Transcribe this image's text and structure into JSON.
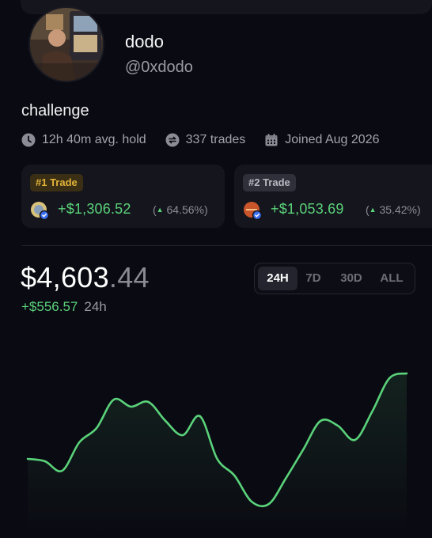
{
  "profile": {
    "display_name": "dodo",
    "handle": "@0xdodo",
    "bio": "challenge"
  },
  "stats": [
    {
      "icon": "clock-icon",
      "label": "12h 40m avg. hold"
    },
    {
      "icon": "swap-icon",
      "label": "337 trades"
    },
    {
      "icon": "calendar-icon",
      "label": "Joined Aug 2026"
    }
  ],
  "trades": [
    {
      "rank": "#1 Trade",
      "pnl": "+$1,306.52",
      "pct": "64.56%)",
      "pct_prefix": "(",
      "token_icon": "token-avatar-icon",
      "badge_color": "#e3b33b"
    },
    {
      "rank": "#2 Trade",
      "pnl": "+$1,053.69",
      "pct": "35.42%)",
      "pct_prefix": "(",
      "token_icon": "token-avatar-icon",
      "badge_color": "#b9b9c2"
    }
  ],
  "portfolio": {
    "balance_main": "$4,603",
    "balance_cents": ".44",
    "change": "+$556.57",
    "change_period": "24h"
  },
  "range_tabs": [
    {
      "label": "24H",
      "active": true
    },
    {
      "label": "7D",
      "active": false
    },
    {
      "label": "30D",
      "active": false
    },
    {
      "label": "ALL",
      "active": false
    }
  ],
  "colors": {
    "background": "#0a0a12",
    "positive": "#5ad27a",
    "card": "#15151d",
    "muted": "#9a9aa3"
  },
  "chart_data": {
    "type": "line",
    "title": "",
    "xlabel": "",
    "ylabel": "",
    "grid": false,
    "series": [
      {
        "values": [
          3400,
          3390,
          3350,
          3470,
          3530,
          3650,
          3620,
          3640,
          3560,
          3500,
          3580,
          3400,
          3330,
          3220,
          3210,
          3320,
          3440,
          3560,
          3540,
          3480,
          3600,
          3740,
          3760
        ]
      }
    ],
    "ylim": [
      3150,
      3800
    ]
  }
}
